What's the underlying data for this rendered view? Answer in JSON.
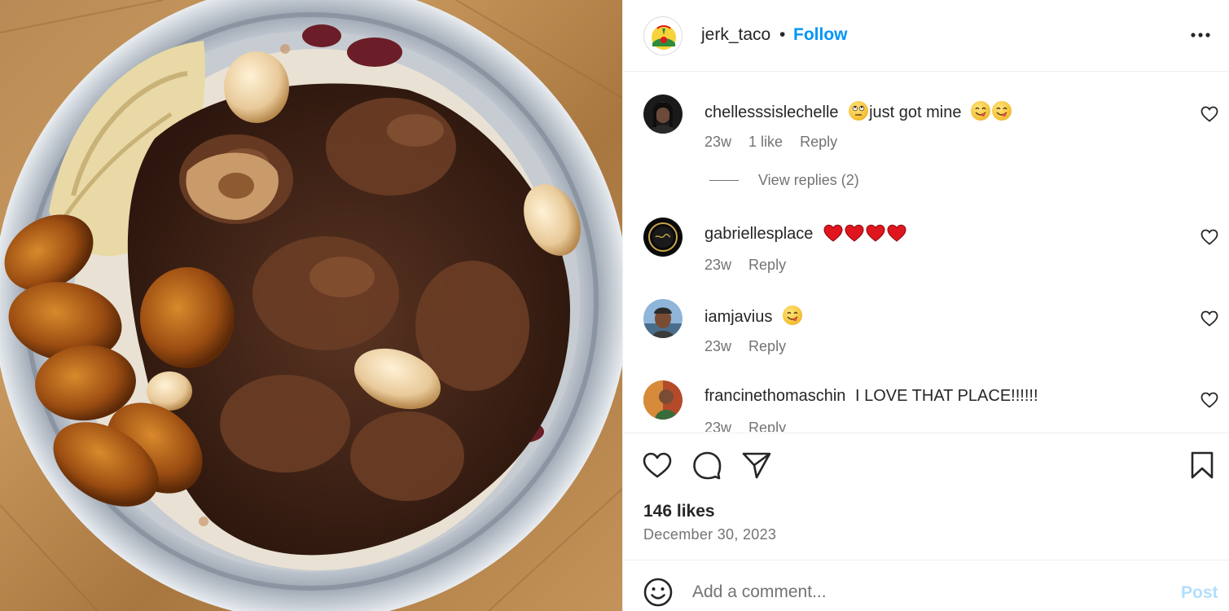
{
  "post": {
    "username": "jerk_taco",
    "separator": "•",
    "follow_label": "Follow",
    "more_icon": "more-horizontal-icon"
  },
  "comments": [
    {
      "username": "chellesssislechelle",
      "text": "just got mine",
      "emoji_before": [
        "face-with-rolling-eyes"
      ],
      "emoji_after": [
        "face-savoring-food",
        "face-savoring-food"
      ],
      "age": "23w",
      "likes": "1 like",
      "reply_label": "Reply"
    },
    {
      "username": "gabriellesplace",
      "text": "",
      "emoji_after": [
        "red-heart",
        "red-heart",
        "red-heart",
        "red-heart"
      ],
      "age": "23w",
      "reply_label": "Reply"
    },
    {
      "username": "iamjavius",
      "text": "",
      "emoji_after": [
        "face-savoring-food"
      ],
      "age": "23w",
      "reply_label": "Reply"
    },
    {
      "username": "francinethomaschin",
      "text": "I LOVE THAT PLACE!!!!!!",
      "age": "23w",
      "reply_label": "Reply"
    }
  ],
  "view_replies_label": "View replies (2)",
  "actions": {
    "like_icon": "heart-outline-icon",
    "comment_icon": "comment-bubble-icon",
    "share_icon": "paper-plane-icon",
    "save_icon": "bookmark-icon"
  },
  "likes_count": "146 likes",
  "post_date": "December 30, 2023",
  "add_comment": {
    "placeholder": "Add a comment...",
    "post_label": "Post",
    "emoji_icon": "smiley-icon"
  },
  "colors": {
    "link_blue": "#0095f6",
    "post_disabled": "#b2dffc",
    "text_primary": "#262626",
    "text_secondary": "#737373",
    "heart_red": "#e0161e"
  }
}
